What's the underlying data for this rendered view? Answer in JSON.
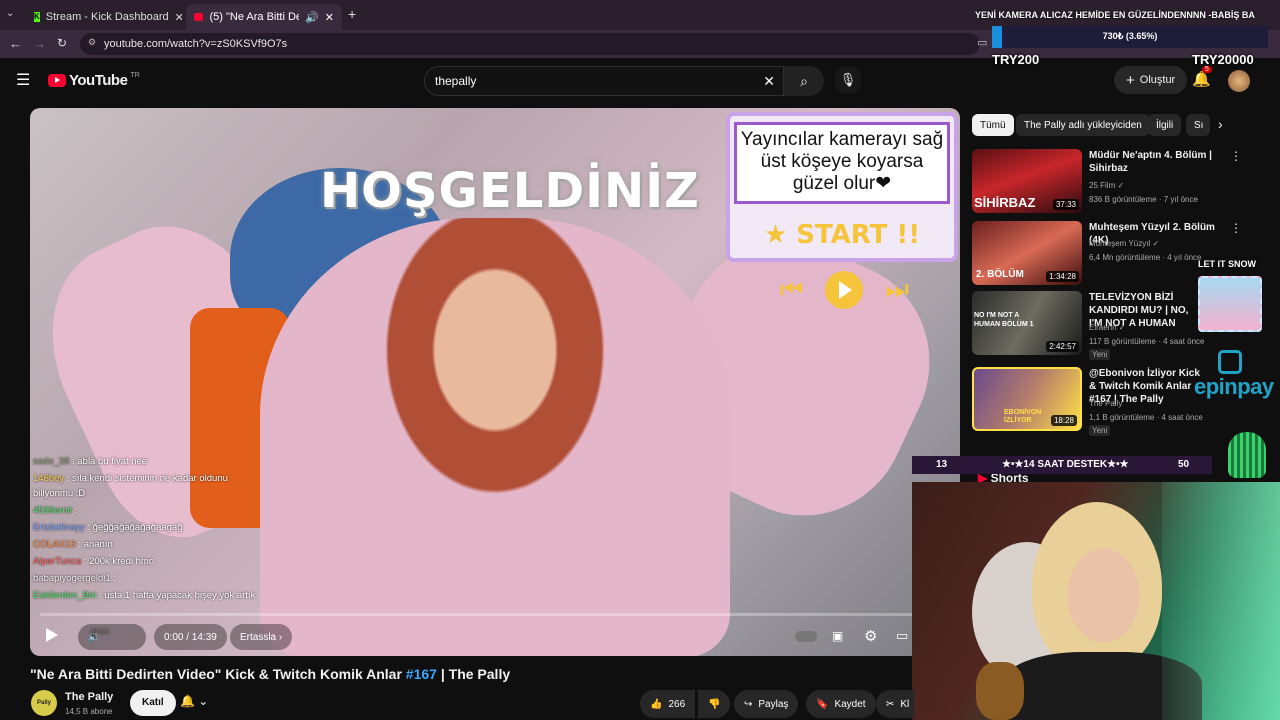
{
  "tabs": [
    {
      "title": "Stream - Kick Dashboard"
    },
    {
      "title": "(5) \"Ne Ara Bitti Dedirten V"
    }
  ],
  "address": {
    "url": "youtube.com/watch?v=zS0KSVf9O7s"
  },
  "youtube": {
    "logo_text": "YouTube",
    "logo_sup": "TR",
    "search_value": "thepally",
    "create_label": "Oluştur",
    "notif_count": "5"
  },
  "player": {
    "welcome_text": "HOŞGELDİNİZ",
    "card_text": "Yayıncılar kamerayı sağ üst köşeye koyarsa güzel olur❤",
    "card_start": "★ START !!",
    "time": "0:00 / 14:39",
    "chapter": "Ertassla",
    "chat": [
      {
        "user": "sado_38",
        "msg": ": abla bu fiyat nee"
      },
      {
        "user": "146bey",
        "msg": ": sıla kendi sisteminin ne kadar oldunu"
      },
      {
        "user": "",
        "msg": "biliyonmu :D"
      },
      {
        "user": "4596emir",
        "msg": ":"
      },
      {
        "user": "Ertsbelinayy",
        "msg": ": ğeğğağağağağaagağ"
      },
      {
        "user": "COLAX13",
        "msg": ": ananın"
      },
      {
        "user": "AlperTunca",
        "msg": ": 200k kredi hmo"
      },
      {
        "user": "babapiyogergeldi1",
        "msg": ":"
      },
      {
        "user": "Eskilerden_Biri",
        "msg": ": usta 1 hafta yapacak bişey yok artık"
      },
      {
        "user": "",
        "msg": "ama"
      }
    ]
  },
  "sidebar": {
    "chips": [
      "Tümü",
      "The Pally adlı yükleyiciden",
      "İlgili",
      "Sı"
    ],
    "items": [
      {
        "title": "Müdür Ne'aptın 4. Bölüm | Sihirbaz",
        "channel": "25 Film",
        "meta": "836 B görüntüleme · 7 yıl önce",
        "duration": "37:33",
        "thumb_text": "SİHİRBAZ",
        "new": ""
      },
      {
        "title": "Muhteşem Yüzyıl 2. Bölüm (4K)",
        "channel": "Muhteşem Yüzyıl",
        "meta": "6,4 Mn görüntüleme · 4 yıl önce",
        "duration": "1:34:28",
        "thumb_text": "2. BÖLÜM",
        "new": ""
      },
      {
        "title": "TELEVİZYON BİZİ KANDIRDI MU? | NO, I'M NOT A HUMAN",
        "channel": "Elraenn",
        "meta": "117 B görüntüleme · 4 saat önce",
        "duration": "2:42:57",
        "thumb_text": "NO I'M NOT A HUMAN BÖLÜM 1",
        "new": "Yeni"
      },
      {
        "title": "@Ebonivon İzliyor Kick & Twitch Komik Anlar #167 | The Pally",
        "channel": "The Pally",
        "meta": "1,1 B görüntüleme · 4 saat önce",
        "duration": "18:28",
        "thumb_text": "EBONİVON İZLİYOR",
        "new": "Yeni"
      }
    ],
    "shorts_label": "Shorts"
  },
  "overlay": {
    "banner": "YENİ KAMERA ALICAZ HEMİDE EN GÜZELİNDENNNN -BABİŞ BARI",
    "goal_text": "730₺ (3.65%)",
    "goal_fraction": 0.0365,
    "goal_left": "TRY200",
    "goal_right": "TRY20000",
    "let_it_snow": "LET IT SNOW",
    "epinpay": "epinpay",
    "destek_left": "13",
    "destek_text": "★•★14 SAAT DESTEK★•★",
    "destek_right": "50"
  },
  "video": {
    "title_main": "\"Ne Ara Bitti Dedirten Video\" Kick & Twitch Komik Anlar ",
    "title_tag": "#167",
    "title_rest": " | The Pally",
    "channel": "The Pally",
    "subs": "14,5 B abone",
    "join_label": "Katıl",
    "likes": "266",
    "share_label": "Paylaş",
    "save_label": "Kaydet",
    "clip_label": "Kl"
  },
  "colors": {
    "accent": "#ff0033",
    "link": "#3ea6ff",
    "goal": "#1a8fe0"
  }
}
